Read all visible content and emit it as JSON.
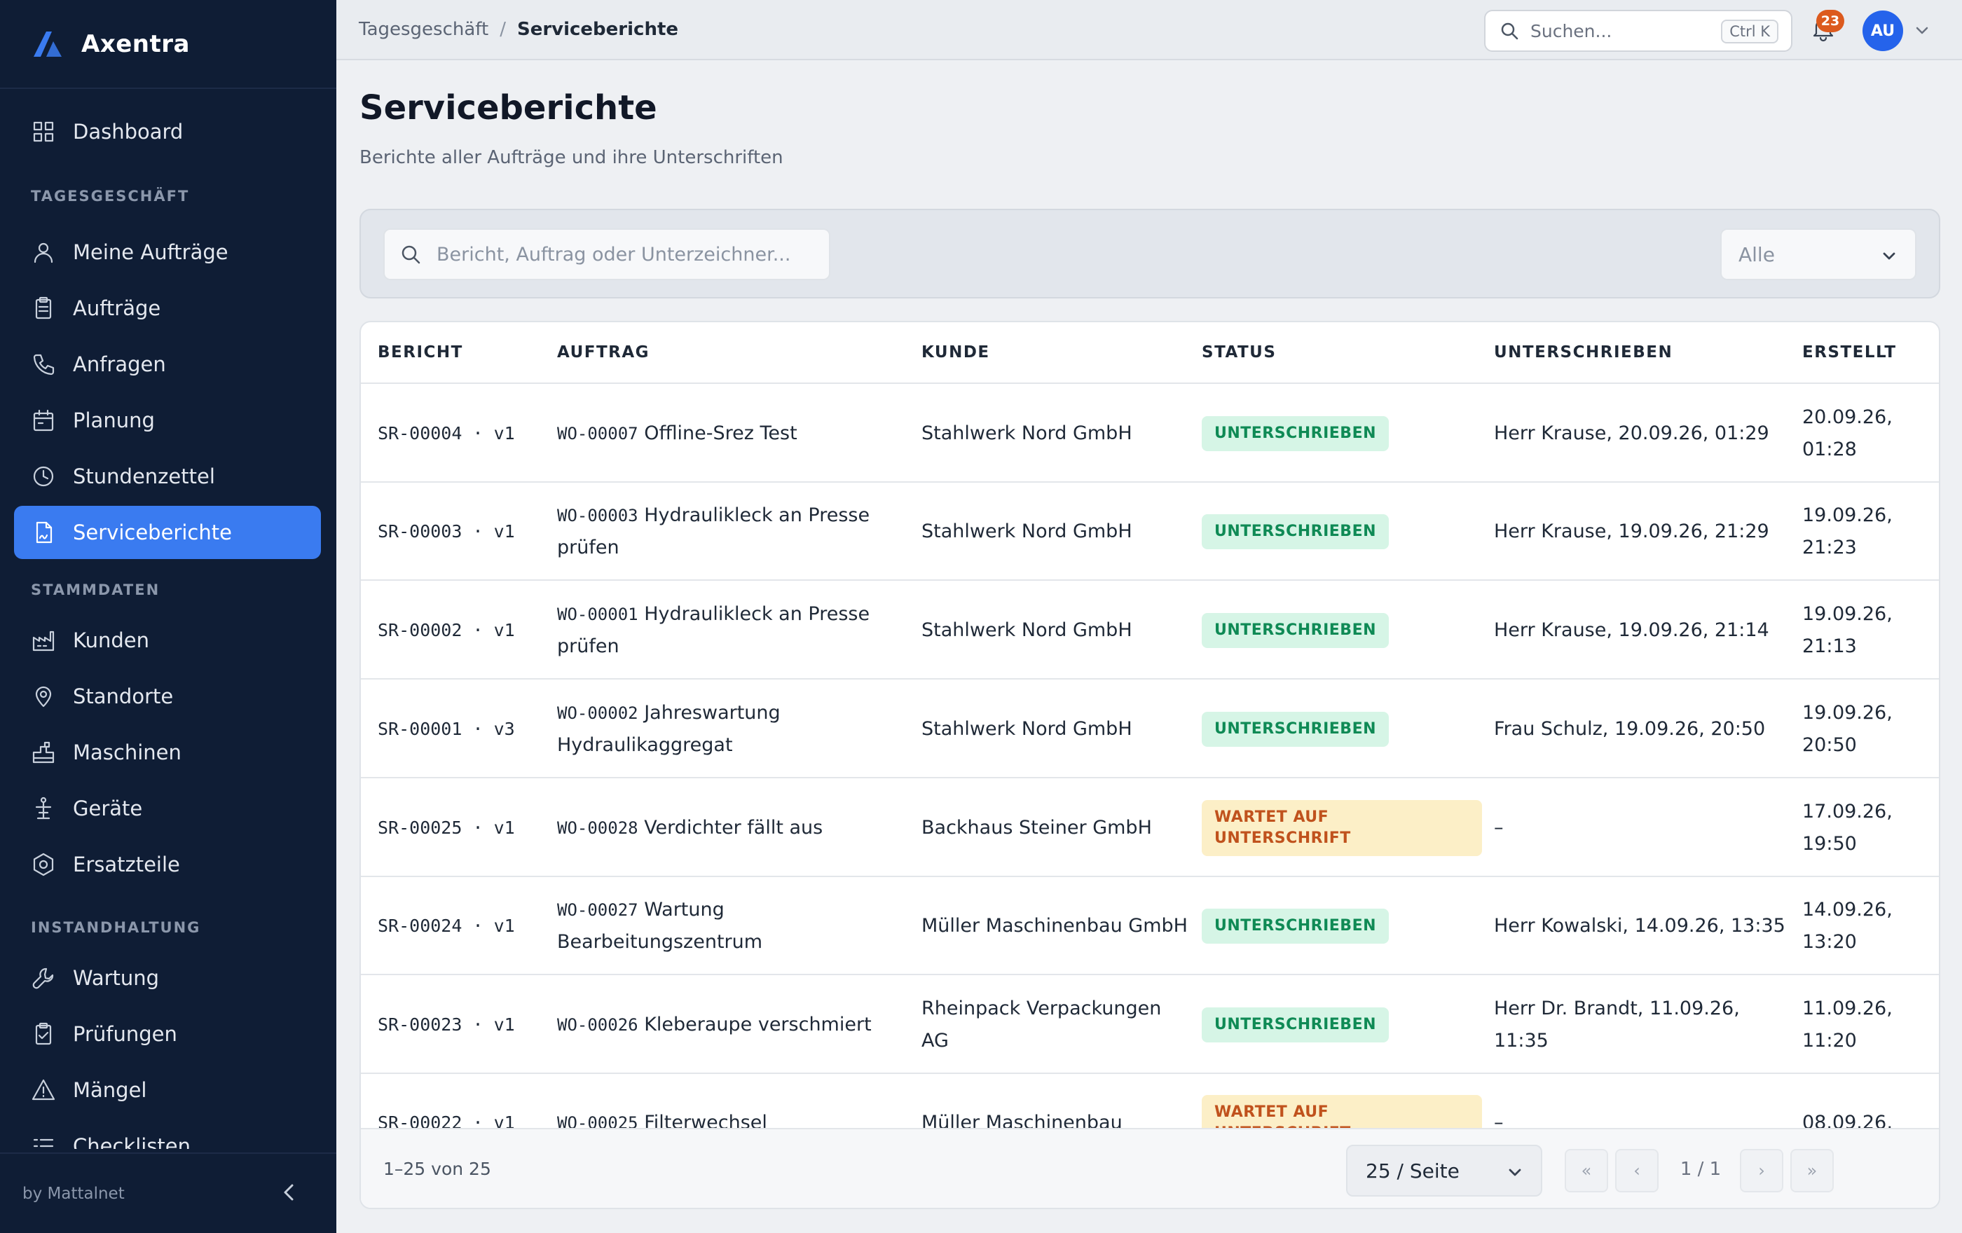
{
  "app": {
    "name": "Axentra",
    "footer": "by Mattalnet"
  },
  "sidebar": {
    "items_top": [
      {
        "label": "Dashboard",
        "icon": "grid-icon"
      }
    ],
    "sections": [
      {
        "title": "TAGESGESCHÄFT",
        "items": [
          {
            "label": "Meine Aufträge",
            "icon": "user-icon"
          },
          {
            "label": "Aufträge",
            "icon": "clipboard-icon"
          },
          {
            "label": "Anfragen",
            "icon": "phone-icon"
          },
          {
            "label": "Planung",
            "icon": "calendar-icon"
          },
          {
            "label": "Stundenzettel",
            "icon": "clock-icon"
          },
          {
            "label": "Serviceberichte",
            "icon": "report-icon",
            "active": true
          }
        ]
      },
      {
        "title": "STAMMDATEN",
        "items": [
          {
            "label": "Kunden",
            "icon": "factory-icon"
          },
          {
            "label": "Standorte",
            "icon": "map-pin-icon"
          },
          {
            "label": "Maschinen",
            "icon": "machine-icon"
          },
          {
            "label": "Geräte",
            "icon": "device-icon"
          },
          {
            "label": "Ersatzteile",
            "icon": "hex-bolt-icon"
          }
        ]
      },
      {
        "title": "INSTANDHALTUNG",
        "items": [
          {
            "label": "Wartung",
            "icon": "wrench-icon"
          },
          {
            "label": "Prüfungen",
            "icon": "clipboard-check-icon"
          },
          {
            "label": "Mängel",
            "icon": "warning-icon"
          },
          {
            "label": "Checklisten",
            "icon": "list-icon"
          }
        ]
      }
    ]
  },
  "topbar": {
    "breadcrumb": [
      "Tagesgeschäft",
      "Serviceberichte"
    ],
    "search_placeholder": "Suchen...",
    "search_shortcut": "Ctrl K",
    "notifications": "23",
    "avatar_initials": "AU"
  },
  "page": {
    "title": "Serviceberichte",
    "subtitle": "Berichte aller Aufträge und ihre Unterschriften",
    "filter_placeholder": "Bericht, Auftrag oder Unterzeichner...",
    "filter_status": "Alle"
  },
  "table": {
    "columns": [
      "BERICHT",
      "AUFTRAG",
      "KUNDE",
      "STATUS",
      "UNTERSCHRIEBEN",
      "ERSTELLT"
    ],
    "rows": [
      {
        "report": "SR-00004 · v1",
        "wo": "WO-00007",
        "title": "Offline-Srez Test",
        "customer": "Stahlwerk Nord GmbH",
        "status": "UNTERSCHRIEBEN",
        "status_color": "green",
        "signed": "Herr Krause, 20.09.26, 01:29",
        "created": "20.09.26, 01:28"
      },
      {
        "report": "SR-00003 · v1",
        "wo": "WO-00003",
        "title": "Hydraulikleck an Presse prüfen",
        "customer": "Stahlwerk Nord GmbH",
        "status": "UNTERSCHRIEBEN",
        "status_color": "green",
        "signed": "Herr Krause, 19.09.26, 21:29",
        "created": "19.09.26, 21:23"
      },
      {
        "report": "SR-00002 · v1",
        "wo": "WO-00001",
        "title": "Hydraulikleck an Presse prüfen",
        "customer": "Stahlwerk Nord GmbH",
        "status": "UNTERSCHRIEBEN",
        "status_color": "green",
        "signed": "Herr Krause, 19.09.26, 21:14",
        "created": "19.09.26, 21:13"
      },
      {
        "report": "SR-00001 · v3",
        "wo": "WO-00002",
        "title": "Jahreswartung Hydraulikaggregat",
        "customer": "Stahlwerk Nord GmbH",
        "status": "UNTERSCHRIEBEN",
        "status_color": "green",
        "signed": "Frau Schulz, 19.09.26, 20:50",
        "created": "19.09.26, 20:50"
      },
      {
        "report": "SR-00025 · v1",
        "wo": "WO-00028",
        "title": "Verdichter fällt aus",
        "customer": "Backhaus Steiner GmbH",
        "status": "WARTET AUF UNTERSCHRIFT",
        "status_color": "amber",
        "signed": "–",
        "created": "17.09.26, 19:50"
      },
      {
        "report": "SR-00024 · v1",
        "wo": "WO-00027",
        "title": "Wartung Bearbeitungszentrum",
        "customer": "Müller Maschinenbau GmbH",
        "status": "UNTERSCHRIEBEN",
        "status_color": "green",
        "signed": "Herr Kowalski, 14.09.26, 13:35",
        "created": "14.09.26, 13:20"
      },
      {
        "report": "SR-00023 · v1",
        "wo": "WO-00026",
        "title": "Kleberaupe verschmiert",
        "customer": "Rheinpack Verpackungen AG",
        "status": "UNTERSCHRIEBEN",
        "status_color": "green",
        "signed": "Herr Dr. Brandt, 11.09.26, 11:35",
        "created": "11.09.26, 11:20"
      },
      {
        "report": "SR-00022 · v1",
        "wo": "WO-00025",
        "title": "Filterwechsel",
        "customer": "Müller Maschinenbau",
        "status": "WARTET AUF UNTERSCHRIFT",
        "status_color": "amber",
        "signed": "–",
        "created": "08.09.26,"
      }
    ]
  },
  "pagination": {
    "range": "1–25 von 25",
    "per_page": "25 / Seite",
    "page": "1 / 1",
    "first": "«",
    "prev": "‹",
    "next": "›",
    "last": "»"
  }
}
